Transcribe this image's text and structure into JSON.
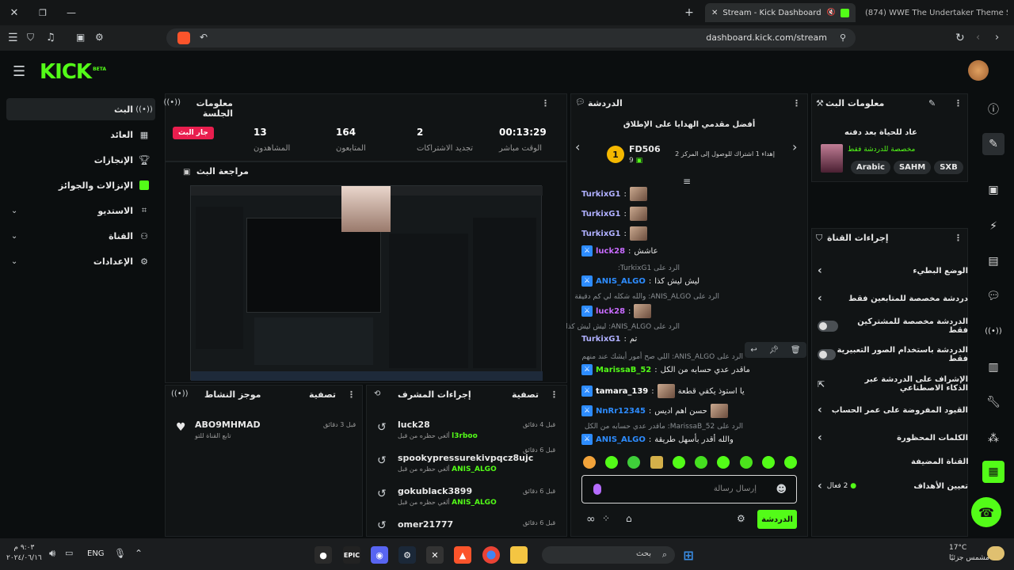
{
  "browser": {
    "tabs": [
      {
        "label": "Stream - Kick Dashboard",
        "active": true
      },
      {
        "label": "(874) WWE The Undertaker Theme S",
        "active": false
      }
    ],
    "url": "dashboard.kick.com/stream"
  },
  "kick": {
    "logo": "KICK",
    "logo_sup": "BETA",
    "accent": "#53fc18"
  },
  "nav": {
    "items": [
      {
        "label": "البث",
        "icon": "live-icon",
        "active": true
      },
      {
        "label": "العائد",
        "icon": "revenue-icon"
      },
      {
        "label": "الإنجازات",
        "icon": "trophy-icon"
      },
      {
        "label": "الإنزالات والجوائز",
        "icon": "drops-icon"
      },
      {
        "label": "الاستديو",
        "icon": "studio-icon",
        "expandable": true
      },
      {
        "label": "القناة",
        "icon": "channel-icon",
        "expandable": true
      },
      {
        "label": "الإعدادات",
        "icon": "settings-icon",
        "expandable": true
      }
    ]
  },
  "session": {
    "title": "معلومات الجلسة",
    "live_badge": "جار البث",
    "stats": [
      {
        "value": "13",
        "label": "المشاهدون"
      },
      {
        "value": "164",
        "label": "المتابعون"
      },
      {
        "value": "2",
        "label": "تجديد الاشتراكات"
      },
      {
        "value": "00:13:29",
        "label": "الوقت مباشر"
      }
    ]
  },
  "preview": {
    "title": "مراجعة البث"
  },
  "chat": {
    "title": "الدردشة",
    "gifters_title": "أفضل مقدمي الهدايا على الإطلاق",
    "top_gifter": {
      "rank": "1",
      "name": "FD506",
      "count": "9"
    },
    "gift_goal": "إهداء 1 اشتراك للوصول إلى المركز 2",
    "messages": [
      {
        "user": "TurkixG1",
        "text": "",
        "color": "#b0b0ff"
      },
      {
        "user": "TurkixG1",
        "text": "",
        "color": "#b0b0ff"
      },
      {
        "user": "TurkixG1",
        "text": "",
        "color": "#b0b0ff"
      },
      {
        "user": "luck28",
        "text": "عاشش",
        "color": "#c86bff",
        "badge": true
      },
      {
        "reply": "الرد على TurkixG1:",
        "user": "ANIS_ALGO",
        "text": "ليش ليش كذا",
        "color": "#2d8cff",
        "badge": true
      },
      {
        "reply": "الرد على ANIS_ALGO: والله شكله لي كم دقيقة",
        "user": "luck28",
        "text": "",
        "color": "#c86bff",
        "badge": true
      },
      {
        "reply": "الرد على ANIS_ALGO: ليش ليش كذا",
        "user": "TurkixG1",
        "text": "تم",
        "color": "#b0b0ff"
      },
      {
        "reply": "الرد على ANIS_ALGO: اللي صح أمور أيشك عند منهم",
        "user": "MarissaB_52",
        "text": "ماقدر عدي حسابه من الكل",
        "color": "#53fc18",
        "badge": true
      },
      {
        "user": "tamara_139",
        "text": "يا استوذ يكفي قطعة",
        "color": "#ffffff",
        "badge": true
      },
      {
        "user": "NnRr12345",
        "text": "حسن اهم اديس",
        "color": "#2d8cff",
        "badge": true
      },
      {
        "reply": "الرد على MarissaB_52: ماقدر عدي حسابه من الكل",
        "user": "ANIS_ALGO",
        "text": "والله أقدر بأسهل طريقة",
        "color": "#2d8cff",
        "badge": true
      }
    ],
    "input_placeholder": "إرسال رسالة",
    "send_label": "الدردشة"
  },
  "stream_info": {
    "title": "معلومات البث",
    "stream_title": "عاد للحياة بعد دفنه",
    "category_note": "مخصصة للدردشة فقط",
    "tags": [
      "Arabic",
      "SAHM",
      "SXB"
    ]
  },
  "channel_actions": {
    "title": "إجراءات القناة",
    "rows": [
      {
        "label": "الوضع البطيء",
        "control": "chevron"
      },
      {
        "label": "دردشة مخصصة للمتابعين فقط",
        "control": "chevron"
      },
      {
        "label": "الدردشة مخصصة للمشتركين فقط",
        "control": "toggle"
      },
      {
        "label": "الدردشة باستخدام الصور التعبيرية فقط",
        "control": "toggle"
      },
      {
        "label": "الإشراف على الدردشة عبر الذكاء الاصطناعي",
        "control": "external"
      },
      {
        "label": "القيود المفروضة على عمر الحساب",
        "control": "chevron"
      },
      {
        "label": "الكلمات المحظورة",
        "control": "chevron"
      }
    ],
    "featured_title": "القناة المضيفة",
    "goals_label": "تعيين الأهداف",
    "goals_count": "2 فعال"
  },
  "activity": {
    "title": "موجز النشاط",
    "filter": "تصفية",
    "items": [
      {
        "user": "ABO9MHMAD",
        "text": "تابع القناة للتو",
        "time": "قبل 3 دقائق"
      }
    ]
  },
  "mod_actions": {
    "title": "إجراءات المشرف",
    "filter": "تصفية",
    "items": [
      {
        "user": "luck28",
        "text": "ألغي حظره من قبل",
        "by": "l3rboo",
        "time": "قبل 4 دقائق"
      },
      {
        "user": "spookypressurekivpqcz8ujc",
        "text": "ألغي حظره من قبل",
        "by": "ANIS_ALGO",
        "time": "قبل 6 دقائق"
      },
      {
        "user": "gokublack3899",
        "text": "ألغي حظره من قبل",
        "by": "ANIS_ALGO",
        "time": "قبل 6 دقائق"
      },
      {
        "user": "omer21777",
        "text": "",
        "by": "",
        "time": "قبل 6 دقائق"
      }
    ]
  },
  "taskbar": {
    "time": "٩:٠٣ م",
    "date": "٢٠٢٤/٠٦/١٦",
    "lang": "ENG",
    "search": "بحث",
    "weather_temp": "17°C",
    "weather_text": "مشمس جزئيًا"
  }
}
